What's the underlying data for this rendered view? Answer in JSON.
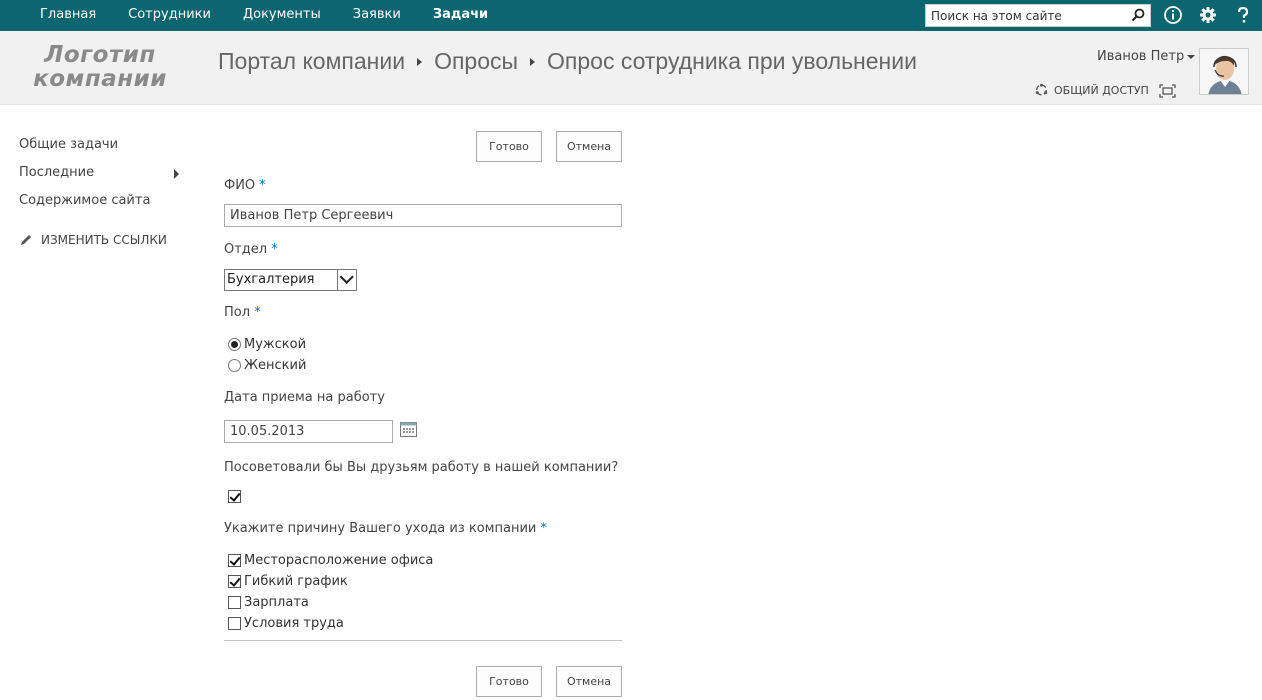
{
  "topnav": {
    "items": [
      {
        "label": "Главная"
      },
      {
        "label": "Сотрудники"
      },
      {
        "label": "Документы"
      },
      {
        "label": "Заявки"
      },
      {
        "label": "Задачи",
        "active": true
      }
    ],
    "search_placeholder": "Поиск на этом сайте",
    "icons": [
      "search-icon",
      "info-icon",
      "gear-icon",
      "help-icon"
    ],
    "background": "#0b6670"
  },
  "header": {
    "logo_line1": "Логотип",
    "logo_line2": "компании",
    "breadcrumb": [
      "Портал компании",
      "Опросы",
      "Опрос сотрудника при увольнении"
    ],
    "user_name": "Иванов Петр",
    "share_label": "ОБЩИЙ ДОСТУП"
  },
  "leftnav": {
    "items": [
      {
        "label": "Общие задачи"
      },
      {
        "label": "Последние"
      },
      {
        "label": "Содержимое сайта"
      }
    ],
    "edit_links": "ИЗМЕНИТЬ ССЫЛКИ"
  },
  "form": {
    "done_label": "Готово",
    "cancel_label": "Отмена",
    "required_mark": "*",
    "fio": {
      "label": "ФИО",
      "value": "Иванов Петр Сергеевич"
    },
    "department": {
      "label": "Отдел",
      "value": "Бухгалтерия"
    },
    "gender": {
      "label": "Пол",
      "options": [
        {
          "label": "Мужской",
          "selected": true
        },
        {
          "label": "Женский",
          "selected": false
        }
      ]
    },
    "hire_date": {
      "label": "Дата приема на работу",
      "value": "10.05.2013"
    },
    "recommend": {
      "label": "Посоветовали бы Вы друзьям работу в нашей компании?",
      "checked": true
    },
    "reason": {
      "label": "Укажите причину Вашего ухода из компании",
      "options": [
        {
          "label": "Месторасположение офиса",
          "checked": true
        },
        {
          "label": "Гибкий график",
          "checked": true
        },
        {
          "label": "Зарплата",
          "checked": false
        },
        {
          "label": "Условия труда",
          "checked": false
        }
      ]
    }
  },
  "colors": {
    "accent": "#0072c6",
    "header_bg": "#f1f1f1"
  }
}
